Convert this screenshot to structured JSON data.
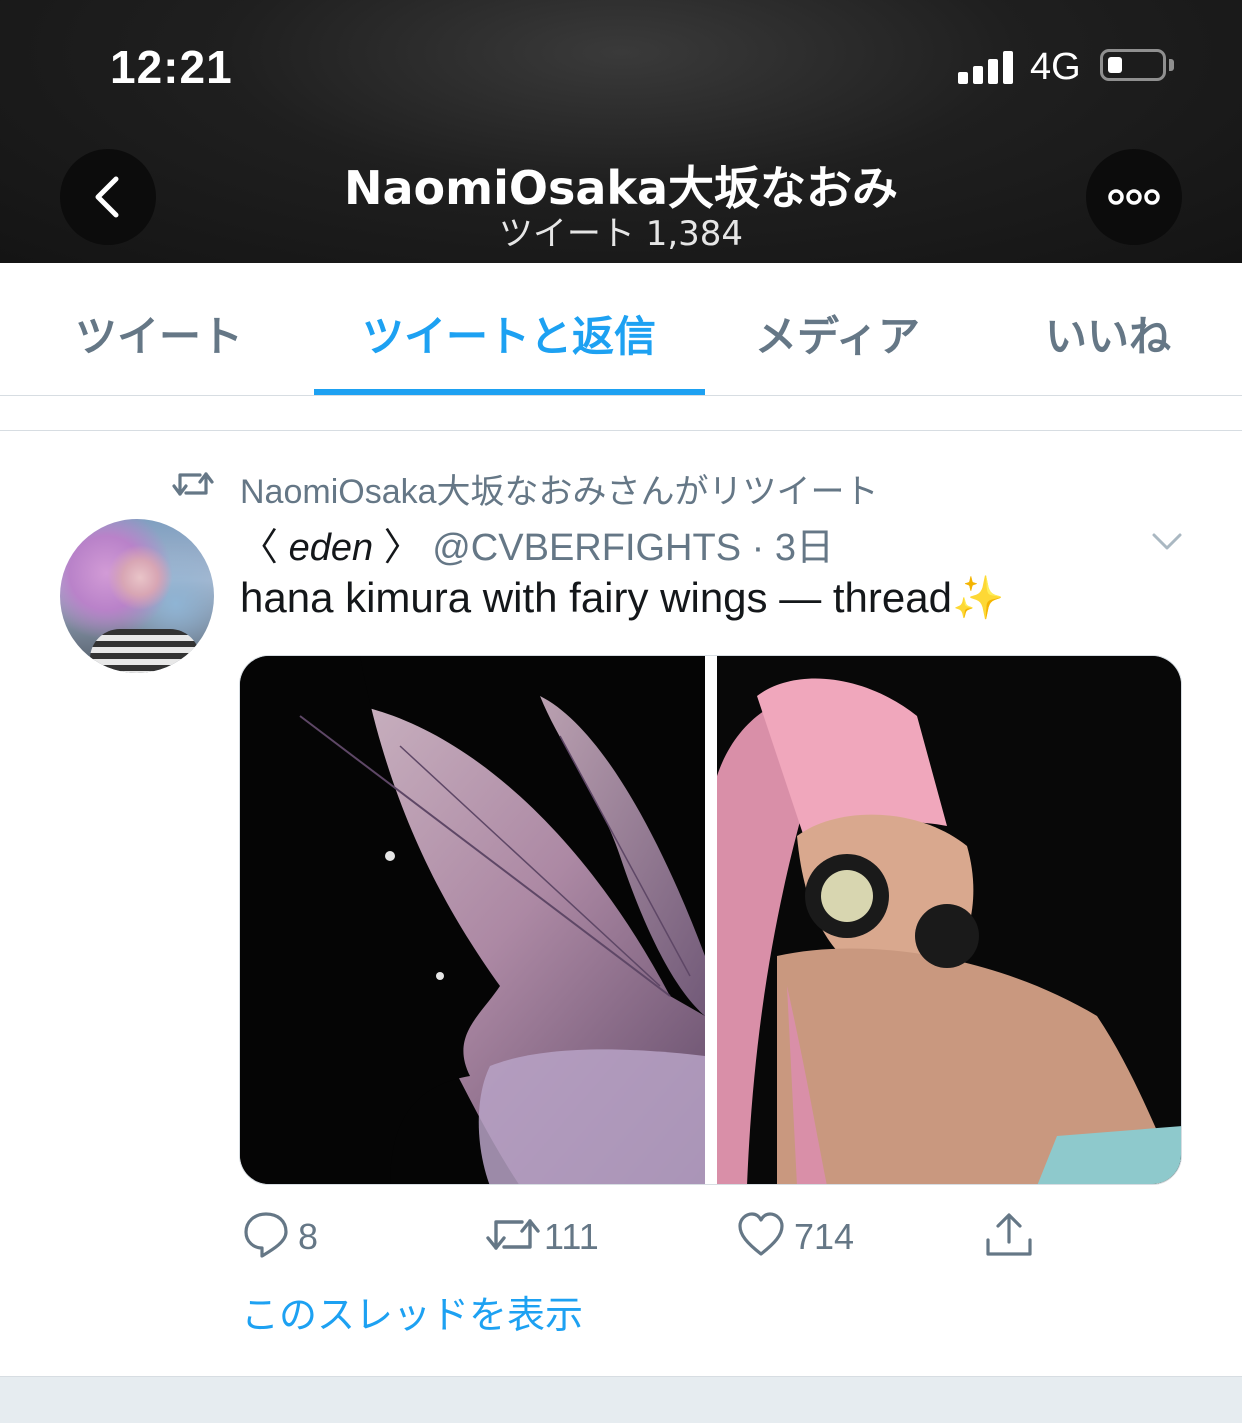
{
  "status_bar": {
    "time": "12:21",
    "network": "4G",
    "signal_icon": "cellular-signal-icon",
    "battery_icon": "battery-low-icon"
  },
  "header": {
    "title": "NaomiOsaka大坂なおみ",
    "subtitle": "ツイート 1,384",
    "back_icon": "chevron-left-icon",
    "more_icon": "more-horizontal-icon"
  },
  "tabs": [
    {
      "label": "ツイート",
      "active": false
    },
    {
      "label": "ツイートと返信",
      "active": true
    },
    {
      "label": "メディア",
      "active": false
    },
    {
      "label": "いいね",
      "active": false
    }
  ],
  "tweet": {
    "retweet_notice": "NaomiOsaka大坂なおみさんがリツイート",
    "display_name_prefix": "〈 ",
    "display_name_main": "eden",
    "display_name_suffix": " 〉",
    "handle_time": " @CVBERFIGHTS · 3日",
    "text": "hana kimura with fairy wings — thread✨",
    "media_count": 2,
    "actions": {
      "replies": "8",
      "retweets": "111",
      "likes": "714"
    },
    "show_thread": "このスレッドを表示"
  },
  "colors": {
    "accent": "#1da1f2",
    "secondary_text": "#657786",
    "primary_text": "#14171a",
    "header_bg": "#1c1c1c"
  }
}
